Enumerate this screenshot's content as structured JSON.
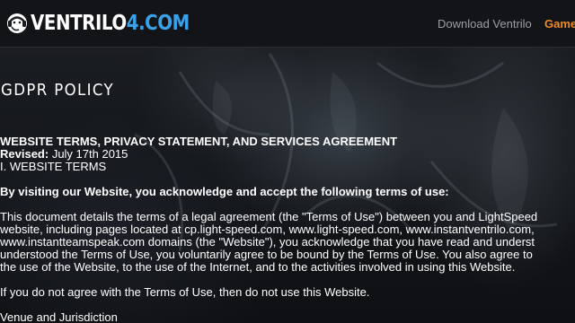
{
  "header": {
    "logo_text_white": "VENTRILO",
    "logo_text_blue": "4.COM",
    "nav": {
      "download": "Download Ventrilo",
      "game": "Game"
    }
  },
  "page": {
    "title": "GDPR POLICY"
  },
  "document": {
    "heading": "WEBSITE TERMS, PRIVACY STATEMENT, AND SERVICES AGREEMENT",
    "revised_label": "Revised:",
    "revised_date": " July 17th 2015",
    "section": "I. WEBSITE TERMS",
    "acknowledge": "By visiting our Website, you acknowledge and accept the following terms of use:",
    "paragraph_lines": [
      "This document details the terms of a legal agreement (the \"Terms of Use\") between you and LightSpeed",
      "website, including pages located at cp.light-speed.com, www.light-speed.com, www.instantventrilo.com,",
      "www.instantteamspeak.com domains (the \"Website\"), you acknowledge that you have read and underst",
      "understood the Terms of Use, you voluntarily agree to be bound by the Terms of Use. You also agree to",
      "the use of the Website, to the use of the Internet, and to the activities involved in using this Website."
    ],
    "disagree": "If you do not agree with the Terms of Use, then do not use this Website.",
    "venue": "Venue and Jurisdiction"
  },
  "colors": {
    "accent_blue": "#3aa0e8",
    "accent_orange": "#f08a24",
    "header_bg": "#121417",
    "nav_gray": "#9aa0a6"
  },
  "icons": {
    "logo": "headset-mascot-icon"
  }
}
